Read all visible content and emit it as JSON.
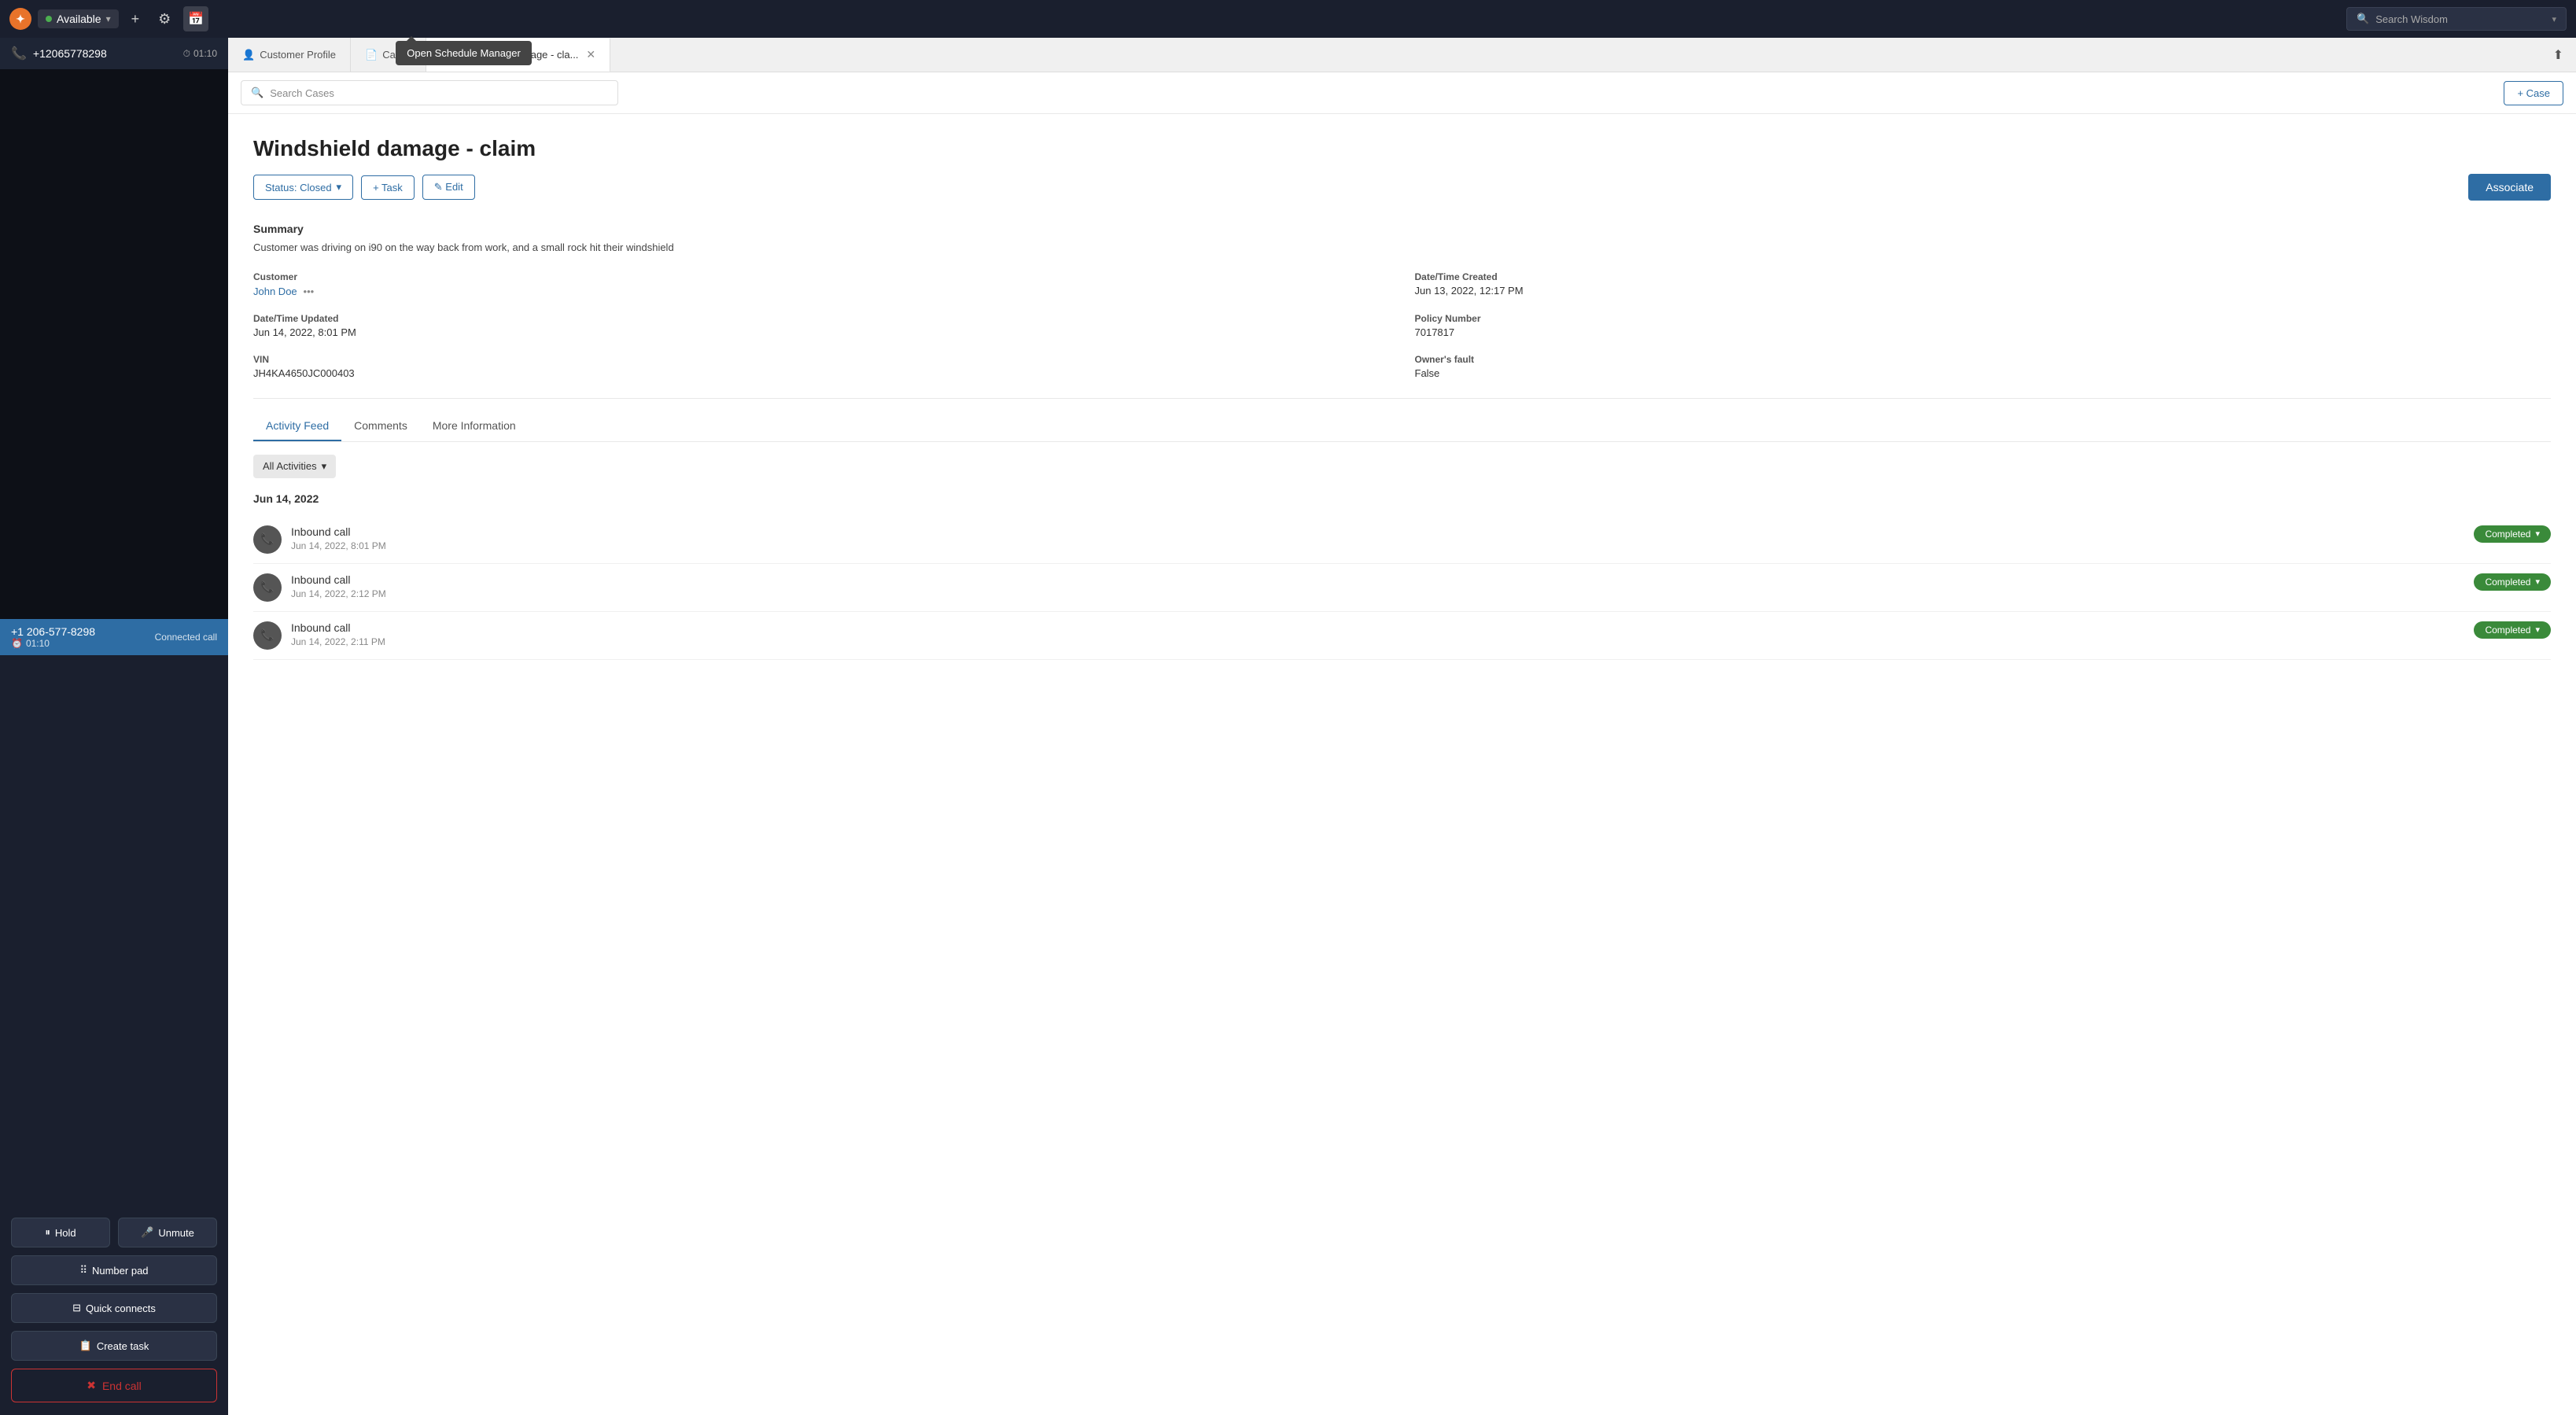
{
  "topNav": {
    "logoText": "✦",
    "status": "Available",
    "statusColor": "#4caf50",
    "plusLabel": "+",
    "gearLabel": "⚙",
    "calendarLabel": "📅",
    "searchWisdomPlaceholder": "Search Wisdom",
    "searchWisdomChevron": "▾",
    "tooltip": "Open Schedule Manager"
  },
  "leftPanel": {
    "callNumber": "+12065778298",
    "timerIcon": "⏱",
    "callDuration": "01:10",
    "connectedNumber": "+1 206-577-8298",
    "connectedTimer": "01:10",
    "connectedLabel": "Connected call",
    "clockIcon": "⏰",
    "holdLabel": "Hold",
    "holdIcon": "⏸",
    "unmuteLabel": "Unmute",
    "unmuteIcon": "🎤",
    "numberPadLabel": "Number pad",
    "numberPadIcon": "⠿",
    "quickConnectsLabel": "Quick connects",
    "quickConnectsIcon": "⊟",
    "createTaskLabel": "Create task",
    "createTaskIcon": "📋",
    "endCallLabel": "End call",
    "endCallIcon": "✖"
  },
  "tabs": [
    {
      "id": "customer-profile",
      "label": "Customer Profile",
      "icon": "👤",
      "active": false,
      "closable": false
    },
    {
      "id": "cases",
      "label": "Cases",
      "icon": "📄",
      "active": false,
      "closable": false
    },
    {
      "id": "windshield",
      "label": "Windshield damage - cla...",
      "icon": "📄",
      "active": true,
      "closable": true
    }
  ],
  "searchBar": {
    "searchCasesPlaceholder": "Search Cases",
    "addCaseLabel": "+ Case"
  },
  "caseDetail": {
    "title": "Windshield damage - claim",
    "statusLabel": "Status: Closed",
    "statusChevron": "▾",
    "taskLabel": "+ Task",
    "editLabel": "✎ Edit",
    "associateLabel": "Associate",
    "summary": {
      "heading": "Summary",
      "text": "Customer was driving on i90 on the way back from work, and a small rock hit their windshield"
    },
    "fields": [
      {
        "label": "Customer",
        "value": "John Doe",
        "isLink": true,
        "hasDots": true,
        "side": "left"
      },
      {
        "label": "Date/Time Created",
        "value": "Jun 13, 2022, 12:17 PM",
        "isLink": false,
        "side": "right"
      },
      {
        "label": "Date/Time Updated",
        "value": "Jun 14, 2022, 8:01 PM",
        "isLink": false,
        "side": "left"
      },
      {
        "label": "Policy Number",
        "value": "7017817",
        "isLink": false,
        "side": "right"
      },
      {
        "label": "VIN",
        "value": "JH4KA4650JC000403",
        "isLink": false,
        "side": "left"
      },
      {
        "label": "Owner's fault",
        "value": "False",
        "isLink": false,
        "side": "right"
      }
    ]
  },
  "activitySection": {
    "tabs": [
      {
        "id": "activity-feed",
        "label": "Activity Feed",
        "active": true
      },
      {
        "id": "comments",
        "label": "Comments",
        "active": false
      },
      {
        "id": "more-info",
        "label": "More Information",
        "active": false
      }
    ],
    "allActivitiesLabel": "All Activities",
    "allActivitiesChevron": "▾",
    "dateGroup": "Jun 14, 2022",
    "activities": [
      {
        "id": 1,
        "name": "Inbound call",
        "time": "Jun 14, 2022, 8:01 PM",
        "status": "Completed"
      },
      {
        "id": 2,
        "name": "Inbound call",
        "time": "Jun 14, 2022, 2:12 PM",
        "status": "Completed"
      },
      {
        "id": 3,
        "name": "Inbound call",
        "time": "Jun 14, 2022, 2:11 PM",
        "status": "Completed"
      }
    ]
  }
}
